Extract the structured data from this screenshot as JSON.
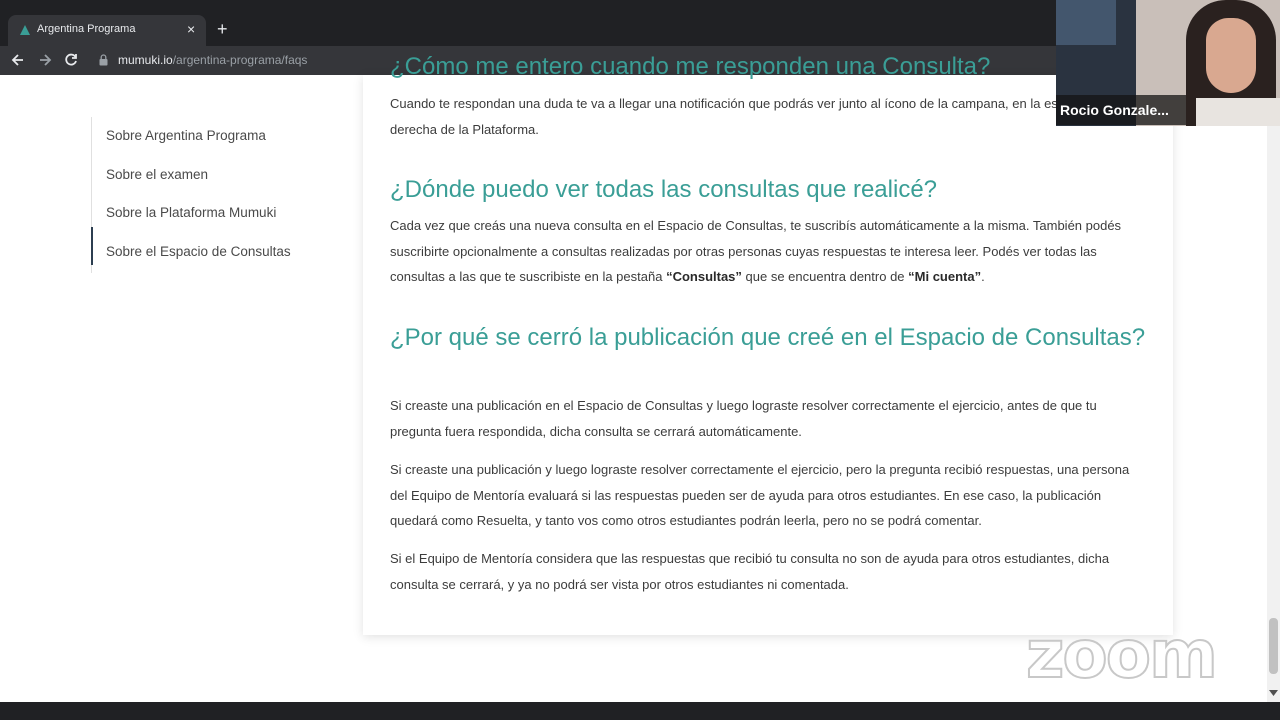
{
  "browser": {
    "tab_title": "Argentina Programa",
    "tab_close": "×",
    "new_tab": "+",
    "url_host": "mumuki.io",
    "url_path": "/argentina-programa/faqs",
    "icons": [
      "tab-favicon-icon",
      "back-arrow-icon",
      "forward-arrow-icon",
      "reload-icon",
      "lock-icon"
    ]
  },
  "sidebar": {
    "items": [
      {
        "label": "Sobre Argentina Programa"
      },
      {
        "label": "Sobre el examen"
      },
      {
        "label": "Sobre la Plataforma Mumuki"
      },
      {
        "label": "Sobre el Espacio de Consultas"
      }
    ],
    "active_index": 3
  },
  "content": {
    "cut_heading": "¿Cómo me entero cuando me responden una Consulta?",
    "answer_notification": "Cuando te respondan una duda te va a llegar una notificación que podrás ver junto al ícono de la campana, en la esquina superior derecha de la Plataforma.",
    "q_where": "¿Dónde puedo ver todas las consultas que realicé?",
    "a_where": {
      "part1": "Cada vez que creás una nueva consulta en el Espacio de Consultas, te suscribís automáticamente a la misma. También podés suscribirte opcionalmente a consultas realizadas por otras personas cuyas respuestas te interesa leer. Podés ver todas las consultas a las que te suscribiste en la pestaña ",
      "bold1": "“Consultas”",
      "part2": " que se encuentra dentro de ",
      "bold2": "“Mi cuenta”",
      "part3": "."
    },
    "q_closed": "¿Por qué se cerró la publicación que creé en el Espacio de Consultas?",
    "a_closed_1": "Si creaste una publicación en el Espacio de Consultas y luego lograste resolver correctamente el ejercicio, antes de que tu pregunta fuera respondida, dicha consulta se cerrará automáticamente.",
    "a_closed_2": "Si creaste una publicación y luego lograste resolver correctamente el ejercicio, pero la pregunta recibió respuestas, una persona del Equipo de Mentoría evaluará si las respuestas pueden ser de ayuda para otros estudiantes. En ese caso, la publicación quedará como Resuelta, y tanto vos como otros estudiantes podrán leerla, pero no se podrá comentar.",
    "a_closed_3": "Si el Equipo de Mentoría considera que las respuestas que recibió tu consulta no son de ayuda para otros estudiantes, dicha consulta se cerrará, y ya no podrá ser vista por otros estudiantes ni comentada."
  },
  "video_overlay": {
    "participant_name": "Rocio Gonzale...",
    "watermark": "zoom"
  },
  "colors": {
    "heading": "#3a9e96",
    "chrome_dark": "#202124",
    "chrome_toolbar": "#35363a"
  }
}
